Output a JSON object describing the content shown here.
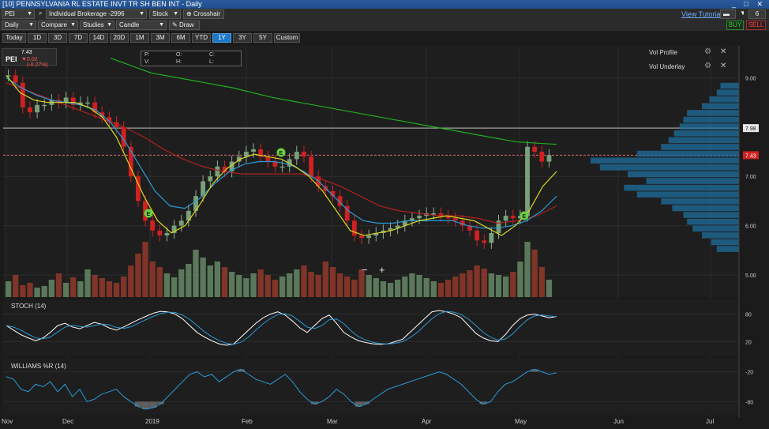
{
  "window": {
    "title": "[10] PENNSYLVANIA RL ESTATE INVT TR SH BEN INT - Daily",
    "controls": "_ □ ✕"
  },
  "toolbar1": {
    "symbol": "PEI",
    "account": "Individual Brokerage -2996",
    "type": "Stock",
    "crosshair": "Crosshair",
    "view_tutorial": "View Tutorial",
    "num_charts": "6"
  },
  "toolbar2": {
    "interval": "Daily",
    "compare": "Compare",
    "studies": "Studies",
    "style": "Candle",
    "draw": "Draw",
    "buy": "BUY",
    "sell": "SELL"
  },
  "ranges": [
    "Today",
    "1D",
    "3D",
    "7D",
    "14D",
    "20D",
    "1M",
    "3M",
    "6M",
    "YTD",
    "1Y",
    "3Y",
    "5Y",
    "Custom"
  ],
  "active_range": "1Y",
  "quote": {
    "symbol": "PEI",
    "last": "7.43",
    "change": "0.02 (-0.27%)"
  },
  "ohlc_labels": {
    "p": "P:",
    "o": "O:",
    "c": "C:",
    "v": "V:",
    "h": "H:",
    "l": "L:"
  },
  "vol_profile": {
    "label1": "Vol Profile",
    "label2": "Vol Underlay"
  },
  "price_axis": {
    "ticks": [
      "9.00",
      "8.00",
      "7.00",
      "6.00",
      "5.00"
    ],
    "tag_upper": "7.98",
    "tag_last": "7.43"
  },
  "stoch": {
    "label": "STOCH (14)",
    "ticks": [
      "80",
      "20"
    ]
  },
  "williams": {
    "label": "WILLIAMS %R (14)",
    "ticks": [
      "-20",
      "-80"
    ]
  },
  "x_axis": [
    "Nov",
    "Dec",
    "2019",
    "Feb",
    "Mar",
    "Apr",
    "May",
    "Jun",
    "Jul"
  ],
  "zoom": {
    "minus": "−",
    "plus": "+"
  },
  "event_marker": "E",
  "colors": {
    "up": "#6a8f6a",
    "down": "#d02020",
    "ma_yellow": "#d8d820",
    "ma_blue": "#2a9ad8",
    "ma_red": "#b02020",
    "ma_green": "#20b020",
    "profile": "#1f6f9f"
  },
  "chart_data": {
    "type": "candlestick",
    "x_labels": [
      "Nov",
      "Dec",
      "2019",
      "Feb",
      "Mar",
      "Apr",
      "May",
      "Jun",
      "Jul"
    ],
    "y_ticks": [
      9.0,
      8.0,
      7.0,
      6.0,
      5.0
    ],
    "ylim": [
      4.55,
      9.65
    ],
    "close": [
      9.05,
      8.9,
      8.4,
      8.3,
      8.45,
      8.45,
      8.55,
      8.5,
      8.6,
      8.45,
      8.5,
      8.5,
      8.3,
      8.2,
      8.1,
      8.0,
      7.6,
      7.0,
      6.5,
      6.1,
      5.9,
      5.8,
      5.85,
      6.0,
      6.1,
      6.3,
      6.6,
      6.9,
      7.0,
      7.2,
      7.1,
      7.3,
      7.4,
      7.5,
      7.55,
      7.4,
      7.3,
      7.2,
      7.2,
      7.35,
      7.5,
      7.4,
      7.0,
      6.8,
      6.7,
      6.6,
      6.4,
      6.1,
      5.8,
      5.75,
      5.8,
      5.85,
      5.9,
      5.95,
      6.0,
      6.1,
      6.15,
      6.2,
      6.25,
      6.25,
      6.2,
      6.15,
      6.1,
      6.0,
      5.9,
      5.7,
      5.65,
      5.85,
      6.1,
      6.2,
      6.15,
      6.2,
      7.6,
      7.5,
      7.3,
      7.43
    ],
    "sma_yellow": [
      9.05,
      8.7,
      8.55,
      8.5,
      8.5,
      8.5,
      8.4,
      8.2,
      7.8,
      7.2,
      6.6,
      6.1,
      5.85,
      6.0,
      6.4,
      6.85,
      7.15,
      7.35,
      7.45,
      7.4,
      7.35,
      7.2,
      7.0,
      6.7,
      6.3,
      5.9,
      5.8,
      5.85,
      5.9,
      6.0,
      6.1,
      6.15,
      6.2,
      6.15,
      6.1,
      5.95,
      5.8,
      6.0,
      6.3,
      6.8,
      7.1
    ],
    "sma_blue": [
      9.0,
      8.8,
      8.65,
      8.55,
      8.5,
      8.45,
      8.35,
      8.1,
      7.7,
      7.2,
      6.7,
      6.4,
      6.35,
      6.55,
      6.85,
      7.1,
      7.25,
      7.3,
      7.3,
      7.25,
      7.1,
      6.9,
      6.6,
      6.3,
      6.1,
      6.05,
      6.05,
      6.1,
      6.1,
      6.1,
      6.1,
      6.0,
      5.95,
      5.95,
      6.0,
      6.1,
      6.3,
      6.6
    ],
    "sma_red": [
      8.9,
      8.75,
      8.6,
      8.45,
      8.3,
      8.15,
      8.0,
      7.8,
      7.55,
      7.35,
      7.2,
      7.1,
      7.05,
      7.05,
      7.05,
      7.05,
      6.95,
      6.8,
      6.6,
      6.4,
      6.3,
      6.25,
      6.2,
      6.2,
      6.15,
      6.05,
      6.1,
      6.2,
      6.4
    ],
    "sma_green": [
      9.4,
      9.1,
      8.95,
      8.8,
      8.6,
      8.45,
      8.3,
      8.15,
      8.0,
      7.85,
      7.7,
      7.65
    ],
    "volume_profile": [
      0.1,
      0.12,
      0.16,
      0.2,
      0.28,
      0.3,
      0.32,
      0.35,
      0.38,
      0.42,
      0.55,
      0.8,
      0.75,
      0.6,
      0.5,
      0.62,
      0.55,
      0.42,
      0.36,
      0.3,
      0.28,
      0.25,
      0.2,
      0.15,
      0.12
    ],
    "stoch_k": [
      55,
      45,
      35,
      28,
      22,
      28,
      40,
      55,
      60,
      52,
      48,
      55,
      62,
      58,
      50,
      45,
      52,
      60,
      68,
      75,
      82,
      86,
      85,
      80,
      70,
      55,
      40,
      30,
      22,
      15,
      12,
      15,
      30,
      45,
      60,
      72,
      80,
      85,
      78,
      65,
      50,
      40,
      55,
      70,
      78,
      60,
      40,
      30,
      22,
      18,
      15,
      14,
      15,
      20,
      25,
      40,
      55,
      70,
      85,
      88,
      85,
      80,
      72,
      55,
      38,
      28,
      22,
      20,
      35,
      55,
      70,
      78,
      80,
      76,
      72,
      75
    ],
    "williams": [
      -30,
      -35,
      -55,
      -60,
      -45,
      -50,
      -40,
      -60,
      -45,
      -70,
      -55,
      -80,
      -75,
      -65,
      -60,
      -55,
      -70,
      -80,
      -90,
      -95,
      -92,
      -85,
      -70,
      -55,
      -40,
      -25,
      -20,
      -30,
      -25,
      -40,
      -30,
      -20,
      -15,
      -25,
      -35,
      -40,
      -45,
      -35,
      -25,
      -40,
      -60,
      -75,
      -85,
      -80,
      -70,
      -55,
      -65,
      -80,
      -90,
      -85,
      -75,
      -65,
      -55,
      -50,
      -45,
      -40,
      -35,
      -30,
      -25,
      -20,
      -25,
      -35,
      -45,
      -60,
      -75,
      -85,
      -80,
      -60,
      -45,
      -40,
      -30,
      -20,
      -15,
      -20,
      -25,
      -22
    ]
  }
}
